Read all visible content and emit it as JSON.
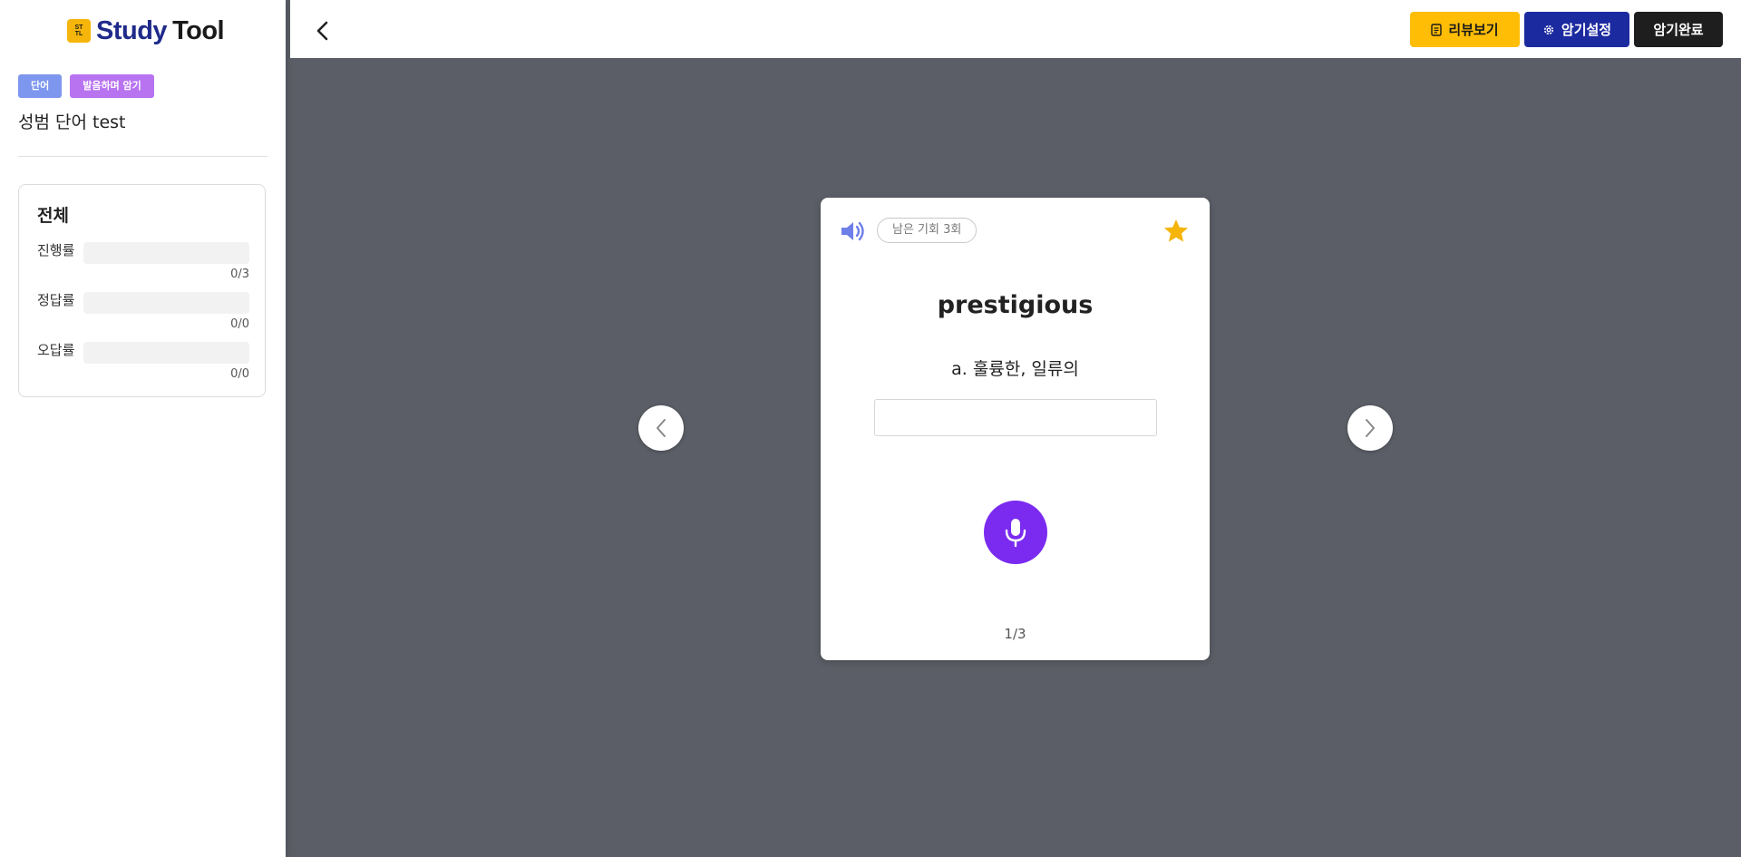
{
  "app": {
    "logo_mark": "STUDY\nTOOL",
    "logo_study": "Study",
    "logo_tool": "Tool"
  },
  "sidebar": {
    "tags": [
      "단어",
      "발음하며 암기"
    ],
    "set_title": "성범 단어 test",
    "stats": {
      "heading": "전체",
      "rows": [
        {
          "label": "진행률",
          "count": "0/3",
          "progress": 0
        },
        {
          "label": "정답률",
          "count": "0/0",
          "progress": 0
        },
        {
          "label": "오답률",
          "count": "0/0",
          "progress": 0
        }
      ]
    }
  },
  "topbar": {
    "review_label": "리뷰보기",
    "settings_label": "암기설정",
    "done_label": "암기완료"
  },
  "card": {
    "remaining_chances": "남은 기회 3회",
    "word": "prestigious",
    "meaning": "a. 훌륭한, 일류의",
    "answer_value": "",
    "answer_placeholder": "",
    "page": "1/3",
    "starred": true
  },
  "colors": {
    "accent_blue": "#1c2aa0",
    "accent_yellow": "#ffbd05",
    "mic_purple": "#7a2bef",
    "speaker_blue": "#6f7fe8",
    "star_yellow": "#f5b50a",
    "stage_bg": "#5b5e66"
  }
}
